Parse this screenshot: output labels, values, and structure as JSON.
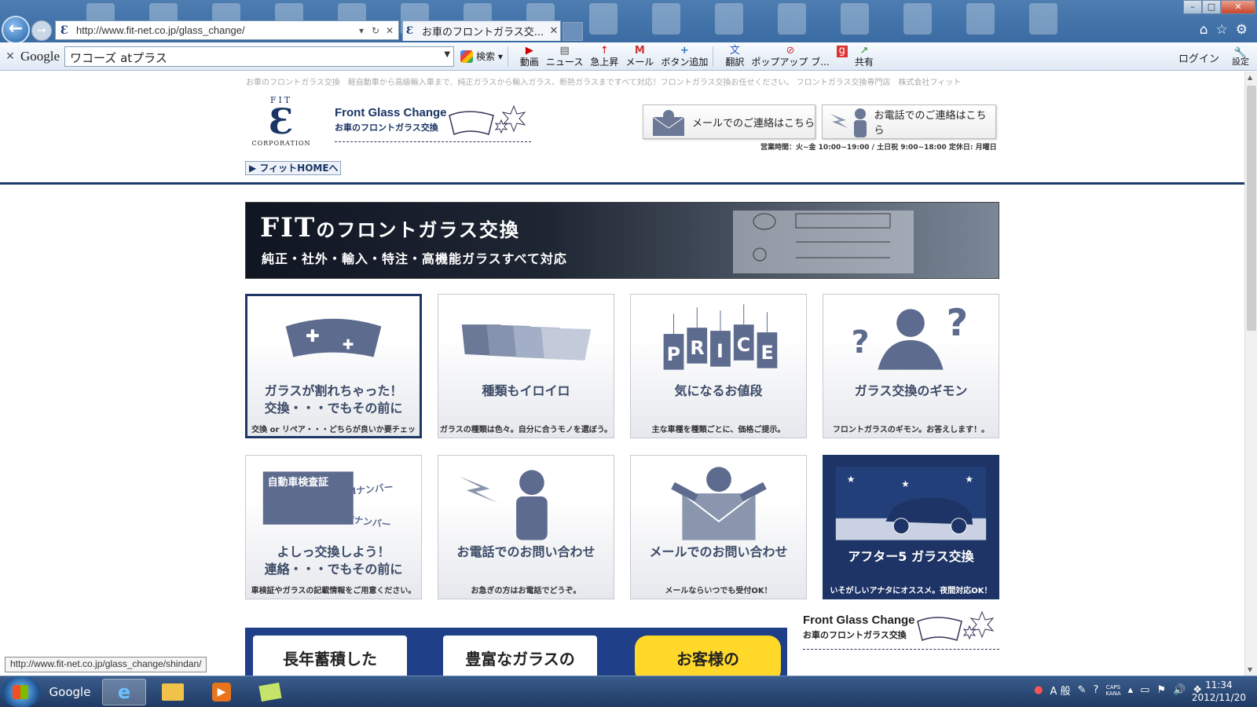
{
  "browser": {
    "back_glyph": "←",
    "forward_glyph": "→",
    "url": "http://www.fit-net.co.jp/glass_change/",
    "tab_title": "お車のフロントガラス交...",
    "window_controls": [
      "–",
      "□",
      "✕"
    ],
    "tab_close": "✕",
    "favicon": "Ɛ"
  },
  "google_bar": {
    "logo": "Google",
    "query": "ワコーズ atプラス",
    "search_label": "検索",
    "buttons": [
      {
        "icon": "youtube-icon",
        "glyph": "▶",
        "label": "動画"
      },
      {
        "icon": "news-icon",
        "glyph": "▤",
        "label": "ニュース"
      },
      {
        "icon": "trending-icon",
        "glyph": "↑",
        "label": "急上昇"
      },
      {
        "icon": "gmail-icon",
        "glyph": "M",
        "label": "メール"
      },
      {
        "icon": "add-button-icon",
        "glyph": "+",
        "label": "ボタン追加"
      },
      {
        "icon": "translate-icon",
        "glyph": "文",
        "label": "翻訳"
      },
      {
        "icon": "popup-blocker-icon",
        "glyph": "⊘",
        "label": "ポップアップ ブ..."
      },
      {
        "icon": "share-icon",
        "glyph": "↗",
        "label": "共有"
      }
    ],
    "login": "ログイン",
    "settings": "設定"
  },
  "page": {
    "breadcrumb": "お車のフロントガラス交換　軽自動車から高級輸入車まで、純正ガラスから輸入ガラス、断熱ガラスまですべて対応！フロントガラス交換お任せください。 フロントガラス交換専門店　株式会社フィット",
    "logo": {
      "top": "FIT",
      "corp": "CORPORATION"
    },
    "header_title_en": "Front Glass Change",
    "header_title_ja": "お車のフロントガラス交換",
    "home_button": "フィットHOMEへ",
    "mail_contact": "メールでのご連絡はこちら",
    "phone_contact": "お電話でのご連絡はこちら",
    "hours": "営業時間：火~金 10:00~19:00 / 土日祝 9:00~18:00  定休日: 月曜日",
    "banner": {
      "title_fit": "FIT",
      "title_rest": "のフロントガラス交換",
      "subtitle": "純正・社外・輸入・特注・高機能ガラスすべて対応"
    },
    "cards": [
      {
        "title": "ガラスが割れちゃった！\n交換・・・でもその前に",
        "sub": "交換 or リペア・・・どちらが良いか要チェック!"
      },
      {
        "title": "種類もイロイロ",
        "sub": "ガラスの種類は色々。自分に合うモノを選ぼう。"
      },
      {
        "title": "気になるお値段",
        "sub": "主な車種を種類ごとに、価格ご提示。"
      },
      {
        "title": "ガラス交換のギモン",
        "sub": "フロントガラスのギモン。お答えします！。"
      },
      {
        "title": "よしっ交換しよう！\n連絡・・・でもその前に",
        "sub": "車検証やガラスの記載情報をご用意ください。"
      },
      {
        "title": "お電話でのお問い合わせ",
        "sub": "お急ぎの方はお電話でどうぞ。"
      },
      {
        "title": "メールでのお問い合わせ",
        "sub": "メールならいつでも受付OK！"
      },
      {
        "title": "アフター5 ガラス交換",
        "sub": "いそがしいアナタにオススメ。夜間対応OK！"
      }
    ],
    "card5_labels": {
      "doc": "自動車検査証",
      "m": "Mナンバー",
      "dot": "DOTナンバー"
    },
    "price_letters": [
      "P",
      "R",
      "I",
      "C",
      "E"
    ],
    "strip_boxes": [
      "長年蓄積した",
      "豊富なガラスの",
      "お客様の"
    ],
    "footer_title_en": "Front Glass Change",
    "footer_title_ja": "お車のフロントガラス交換"
  },
  "status_url": "http://www.fit-net.co.jp/glass_change/shindan/",
  "taskbar": {
    "google_label": "Google",
    "ime": "A 般",
    "caps": "CAPS",
    "kana": "KANA",
    "time": "11:34",
    "date": "2012/11/20"
  },
  "colors": {
    "brand_navy": "#1e3466",
    "icon_slate": "#5d6b8f"
  }
}
